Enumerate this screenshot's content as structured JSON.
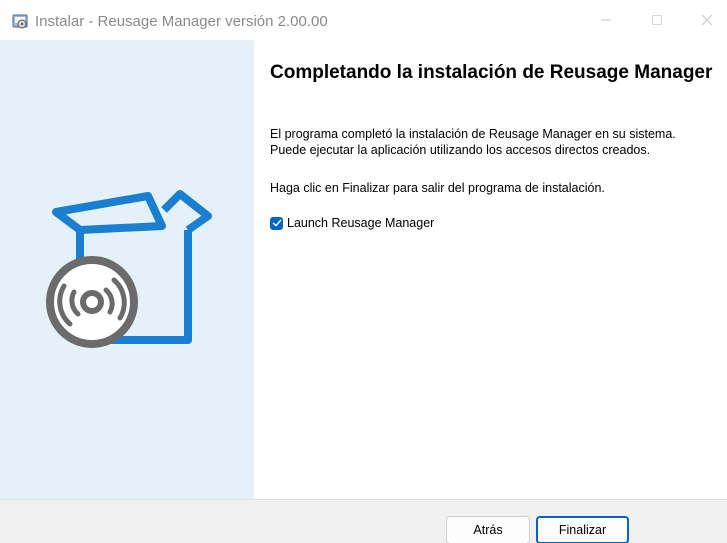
{
  "window": {
    "title": "Instalar - Reusage Manager versión 2.00.00"
  },
  "content": {
    "heading": "Completando la instalación de Reusage Manager",
    "paragraph1_line1": "El programa completó la instalación de Reusage Manager en su sistema.",
    "paragraph1_line2": "Puede ejecutar la aplicación utilizando los accesos directos creados.",
    "paragraph2": "Haga clic en Finalizar para salir del programa de instalación.",
    "launch_checkbox": {
      "label": "Launch Reusage Manager",
      "checked": true
    }
  },
  "buttons": {
    "back_label": "Atrás",
    "finish_label": "Finalizar"
  },
  "icons": {
    "app": "installer-icon",
    "minimize": "minimize-icon",
    "maximize": "maximize-icon",
    "close": "close-icon",
    "check": "checkmark-icon",
    "illustration": "box-with-disc-icon"
  },
  "colors": {
    "accent": "#0067c0",
    "illustration_blue": "#1a7fd1",
    "illustration_gray": "#6b6b6b",
    "left_panel_bg": "#e5f1f9",
    "bottom_bar_bg": "#f0f0f0"
  }
}
